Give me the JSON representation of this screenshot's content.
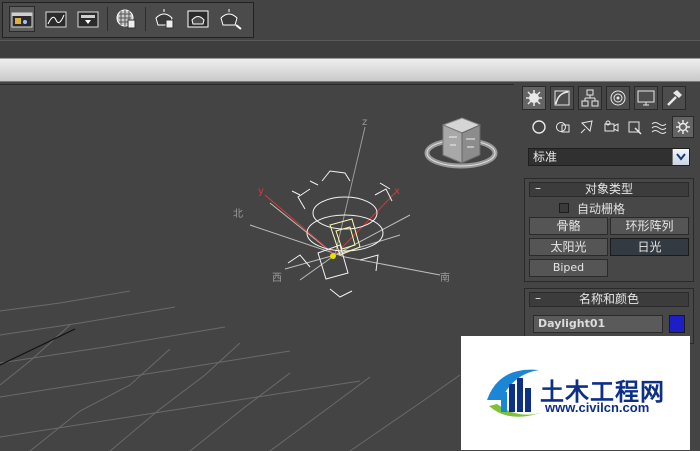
{
  "toolbar": {
    "buttons": [
      {
        "icon": "scene-explorer-icon",
        "active": true
      },
      {
        "icon": "curve-editor-icon",
        "active": false
      },
      {
        "icon": "schematic-view-icon",
        "active": false
      },
      {
        "icon": "material-editor-icon",
        "active": false
      },
      {
        "icon": "render-setup-icon",
        "active": false
      },
      {
        "icon": "rendered-frame-window-icon",
        "active": false
      },
      {
        "icon": "render-production-icon",
        "active": false
      }
    ]
  },
  "viewport": {
    "compass": {
      "north": "北",
      "south": "南",
      "west": "西"
    },
    "axes": {
      "x": "x",
      "y": "y",
      "z": "z"
    }
  },
  "command_panel": {
    "tabs": [
      "create-icon",
      "modify-icon",
      "hierarchy-icon",
      "motion-icon",
      "display-icon",
      "utilities-icon"
    ],
    "subtabs": [
      "geometry-icon",
      "shapes-icon",
      "lights-icon",
      "cameras-icon",
      "helpers-icon",
      "space-warps-icon",
      "systems-icon"
    ],
    "category_dropdown": "标准",
    "object_type": {
      "title": "对象类型",
      "autogrid_label": "自动栅格",
      "buttons": [
        "骨骼",
        "环形阵列",
        "太阳光",
        "日光",
        "Biped"
      ]
    },
    "name_color": {
      "title": "名称和颜色",
      "name_value": "Daylight01",
      "color": "#1d1ec4"
    }
  },
  "watermark": {
    "title": "土木工程网",
    "url": "www.civilcn.com"
  }
}
